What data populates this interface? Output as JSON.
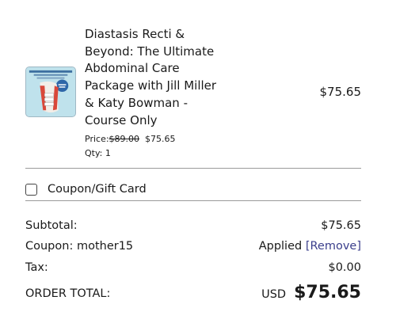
{
  "item": {
    "thumbnail_icon": "course-cover-image",
    "title": "Diastasis Recti & Beyond: The Ultimate Abdominal Care Package with Jill Miller & Katy Bowman - Course Only",
    "line_price": "$75.65",
    "price_label": "Price:",
    "original_price": "$89.00",
    "sale_price": "$75.65",
    "qty_label": "Qty: 1"
  },
  "coupon": {
    "label": "Coupon/Gift Card",
    "checked": false
  },
  "summary": {
    "subtotal_label": "Subtotal:",
    "subtotal_value": "$75.65",
    "coupon_label": "Coupon: mother15",
    "coupon_status": "Applied",
    "remove_label": "[Remove]",
    "tax_label": "Tax:",
    "tax_value": "$0.00",
    "total_label": "ORDER TOTAL:",
    "currency": "USD",
    "total_value": "$75.65"
  },
  "colors": {
    "link": "#3b3f8c",
    "divider": "#9a9a9a",
    "thumbnail_bg": "#b9dde8"
  }
}
